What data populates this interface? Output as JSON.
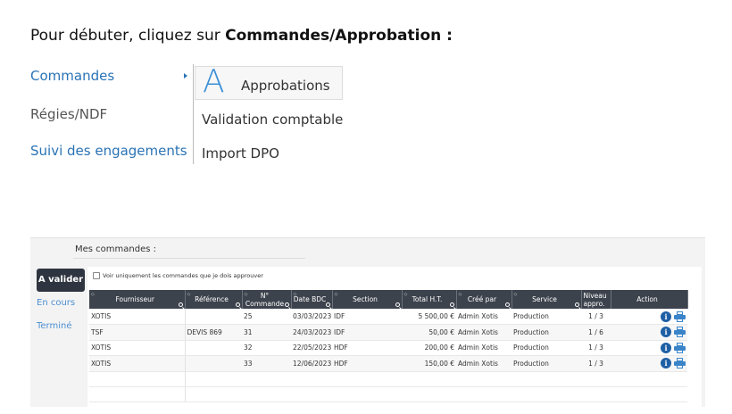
{
  "instruction": {
    "prefix": "Pour débuter, cliquez sur ",
    "bold": "Commandes/Approbation :"
  },
  "menu": {
    "items": [
      "Commandes",
      "Régies/NDF",
      "Suivi des engagements"
    ],
    "submenu_icon_letter": "A",
    "submenu": [
      "Approbations",
      "Validation comptable",
      "Import DPO"
    ]
  },
  "app": {
    "title": "Mes commandes :",
    "tabs": [
      "A valider",
      "En cours",
      "Terminé"
    ],
    "checkbox_label": "Voir uniquement les commandes que je dois approuver",
    "columns": [
      "Fournisseur",
      "Référence",
      "N° Commande",
      "Date BDC",
      "Section",
      "Total H.T.",
      "Créé par",
      "Service",
      "Niveau appro.",
      "Action"
    ],
    "rows": [
      {
        "fournisseur": "XOTIS",
        "reference": "",
        "numero": "25",
        "date": "03/03/2023",
        "section": "IDF",
        "total": "5 500,00 €",
        "cree_par": "Admin Xotis",
        "service": "Production",
        "niveau": "1 / 3"
      },
      {
        "fournisseur": "TSF",
        "reference": "DEVIS 869",
        "numero": "31",
        "date": "24/03/2023",
        "section": "IDF",
        "total": "50,00 €",
        "cree_par": "Admin Xotis",
        "service": "Production",
        "niveau": "1 / 6"
      },
      {
        "fournisseur": "XOTIS",
        "reference": "",
        "numero": "32",
        "date": "22/05/2023",
        "section": "HDF",
        "total": "200,00 €",
        "cree_par": "Admin Xotis",
        "service": "Production",
        "niveau": "1 / 3"
      },
      {
        "fournisseur": "XOTIS",
        "reference": "",
        "numero": "33",
        "date": "12/06/2023",
        "section": "HDF",
        "total": "150,00 €",
        "cree_par": "Admin Xotis",
        "service": "Production",
        "niveau": "1 / 3"
      }
    ],
    "action_icons": [
      "info-icon",
      "printer-icon"
    ],
    "colors": {
      "header_bg": "#3d434d",
      "active_tab": "#2f3540",
      "link": "#4d8fd0",
      "info": "#1f5fa5"
    }
  }
}
